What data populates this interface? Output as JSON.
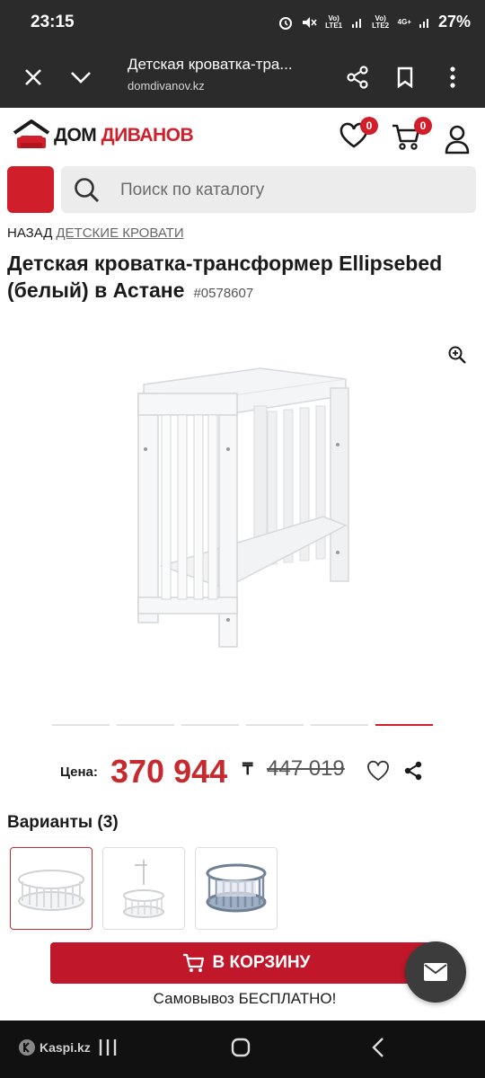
{
  "status": {
    "time": "23:15",
    "sim1": "Vo) LTE1",
    "sim2": "Vo) LTE2",
    "net": "4G+",
    "battery": "27%"
  },
  "browser": {
    "title": "Детская кроватка-тра...",
    "url": "domdivanov.kz"
  },
  "site": {
    "logo_dom": "ДОМ",
    "logo_divanov": "ДИВАНОВ",
    "favorites_count": "0",
    "cart_count": "0"
  },
  "search": {
    "placeholder": "Поиск по каталогу"
  },
  "breadcrumb": {
    "back": "НАЗАД",
    "category": "ДЕТСКИЕ КРОВАТИ"
  },
  "product": {
    "title": "Детская кроватка-трансформер Ellipsebed (белый) в Астане",
    "sku": "#0578607",
    "price_label": "Цена:",
    "price": "370 944",
    "currency": "₸",
    "old_price": "447 019",
    "gallery": {
      "slides": 6,
      "active_slide": 6
    }
  },
  "variants": {
    "title": "Варианты (3)"
  },
  "cart": {
    "button": "В КОРЗИНУ",
    "pickup": "Самовывоз БЕСПЛАТНО!"
  },
  "nav": {
    "kaspi": "Kaspi.kz"
  },
  "colors": {
    "brand_red": "#d01f2a",
    "price_red": "#c62a2e",
    "cart_red": "#c0182a"
  }
}
